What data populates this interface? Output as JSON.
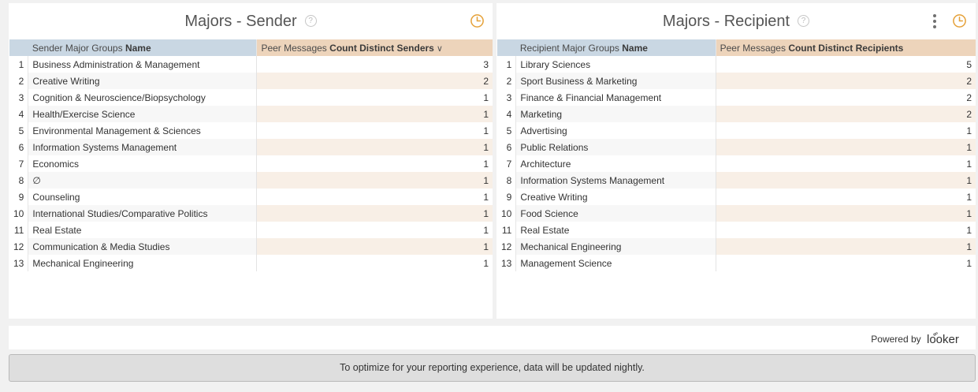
{
  "tiles": [
    {
      "title": "Majors - Sender",
      "help_glyph": "?",
      "headers": {
        "dimension_prefix": "Sender Major Groups",
        "dimension_bold": "Name",
        "measure_prefix": "Peer Messages",
        "measure_bold": "Count Distinct Senders",
        "sort_glyph": "∨"
      },
      "rows": [
        {
          "n": "1",
          "name": "Business Administration & Management",
          "value": "3"
        },
        {
          "n": "2",
          "name": "Creative Writing",
          "value": "2"
        },
        {
          "n": "3",
          "name": "Cognition & Neuroscience/Biopsychology",
          "value": "1"
        },
        {
          "n": "4",
          "name": "Health/Exercise Science",
          "value": "1"
        },
        {
          "n": "5",
          "name": "Environmental Management & Sciences",
          "value": "1"
        },
        {
          "n": "6",
          "name": "Information Systems Management",
          "value": "1"
        },
        {
          "n": "7",
          "name": "Economics",
          "value": "1"
        },
        {
          "n": "8",
          "name": "∅",
          "value": "1"
        },
        {
          "n": "9",
          "name": "Counseling",
          "value": "1"
        },
        {
          "n": "10",
          "name": "International Studies/Comparative Politics",
          "value": "1"
        },
        {
          "n": "11",
          "name": "Real Estate",
          "value": "1"
        },
        {
          "n": "12",
          "name": "Communication & Media Studies",
          "value": "1"
        },
        {
          "n": "13",
          "name": "Mechanical Engineering",
          "value": "1"
        }
      ]
    },
    {
      "title": "Majors - Recipient",
      "help_glyph": "?",
      "headers": {
        "dimension_prefix": "Recipient Major Groups",
        "dimension_bold": "Name",
        "measure_prefix": "Peer Messages",
        "measure_bold": "Count Distinct Recipients"
      },
      "rows": [
        {
          "n": "1",
          "name": "Library Sciences",
          "value": "5"
        },
        {
          "n": "2",
          "name": "Sport Business & Marketing",
          "value": "2"
        },
        {
          "n": "3",
          "name": "Finance & Financial Management",
          "value": "2"
        },
        {
          "n": "4",
          "name": "Marketing",
          "value": "2"
        },
        {
          "n": "5",
          "name": "Advertising",
          "value": "1"
        },
        {
          "n": "6",
          "name": "Public Relations",
          "value": "1"
        },
        {
          "n": "7",
          "name": "Architecture",
          "value": "1"
        },
        {
          "n": "8",
          "name": "Information Systems Management",
          "value": "1"
        },
        {
          "n": "9",
          "name": "Creative Writing",
          "value": "1"
        },
        {
          "n": "10",
          "name": "Food Science",
          "value": "1"
        },
        {
          "n": "11",
          "name": "Real Estate",
          "value": "1"
        },
        {
          "n": "12",
          "name": "Mechanical Engineering",
          "value": "1"
        },
        {
          "n": "13",
          "name": "Management Science",
          "value": "1"
        }
      ]
    }
  ],
  "icons": {
    "clock": "clock-icon",
    "help": "help-icon",
    "kebab": "kebab-menu-icon",
    "sort": "sort-descending-icon"
  },
  "colors": {
    "dimension_header": "#c9d7e3",
    "measure_header": "#edd4bb",
    "measure_stripe": "#f8efe6",
    "clock_accent": "#e5a139"
  },
  "footer": {
    "powered_by": "Powered by",
    "logo_text": "looker"
  },
  "notice": "To optimize for your reporting experience, data will be updated nightly."
}
